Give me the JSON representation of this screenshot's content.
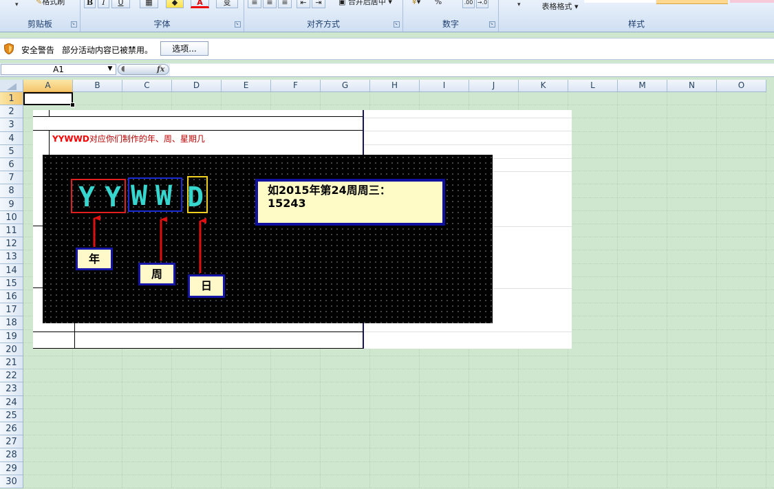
{
  "ribbon": {
    "groups": [
      {
        "label": "剪贴板"
      },
      {
        "label": "字体"
      },
      {
        "label": "对齐方式"
      },
      {
        "label": "数字"
      },
      {
        "label": "样式"
      }
    ],
    "buttons": {
      "format_painter": "格式刷",
      "bold": "B",
      "italic": "I",
      "underline": "U",
      "font_color": "A",
      "wen": "变",
      "merge_center": "合并后居中",
      "percent": "%",
      "table_format": "表格格式"
    }
  },
  "security_bar": {
    "title": "安全警告",
    "message": "部分活动内容已被禁用。",
    "options_button": "选项..."
  },
  "formula_bar": {
    "name_box": "A1",
    "fx": "fx",
    "formula": ""
  },
  "columns": [
    "A",
    "B",
    "C",
    "D",
    "E",
    "F",
    "G",
    "H",
    "I",
    "J",
    "K",
    "L",
    "M",
    "N",
    "O"
  ],
  "rows": [
    "1",
    "2",
    "3",
    "4",
    "5",
    "6",
    "7",
    "8",
    "9",
    "10",
    "11",
    "12",
    "13",
    "14",
    "15",
    "16",
    "17",
    "18",
    "19",
    "20",
    "21",
    "22",
    "23",
    "24",
    "25",
    "26",
    "27",
    "28",
    "29",
    "30"
  ],
  "selected_cell": {
    "column": "A",
    "row": "1"
  },
  "sheet_content": {
    "heading_highlight": "YYWWD",
    "heading_rest": "对应你们制作的年、周、星期几"
  },
  "diagram": {
    "letters": [
      "Y",
      "Y",
      "W",
      "W",
      "D"
    ],
    "labels": {
      "year": "年",
      "week": "周",
      "day": "日"
    },
    "example_line1": "如2015年第24周周三：",
    "example_line2": "15243",
    "colors": {
      "letters": "#36d6cf",
      "year_box": "#e02020",
      "week_box": "#1a2bd6",
      "day_box": "#f0d020",
      "arrows": "#e01010"
    }
  },
  "colors": {
    "grid_background": "#cfe6cf",
    "selected_header": "#f4c66c"
  }
}
